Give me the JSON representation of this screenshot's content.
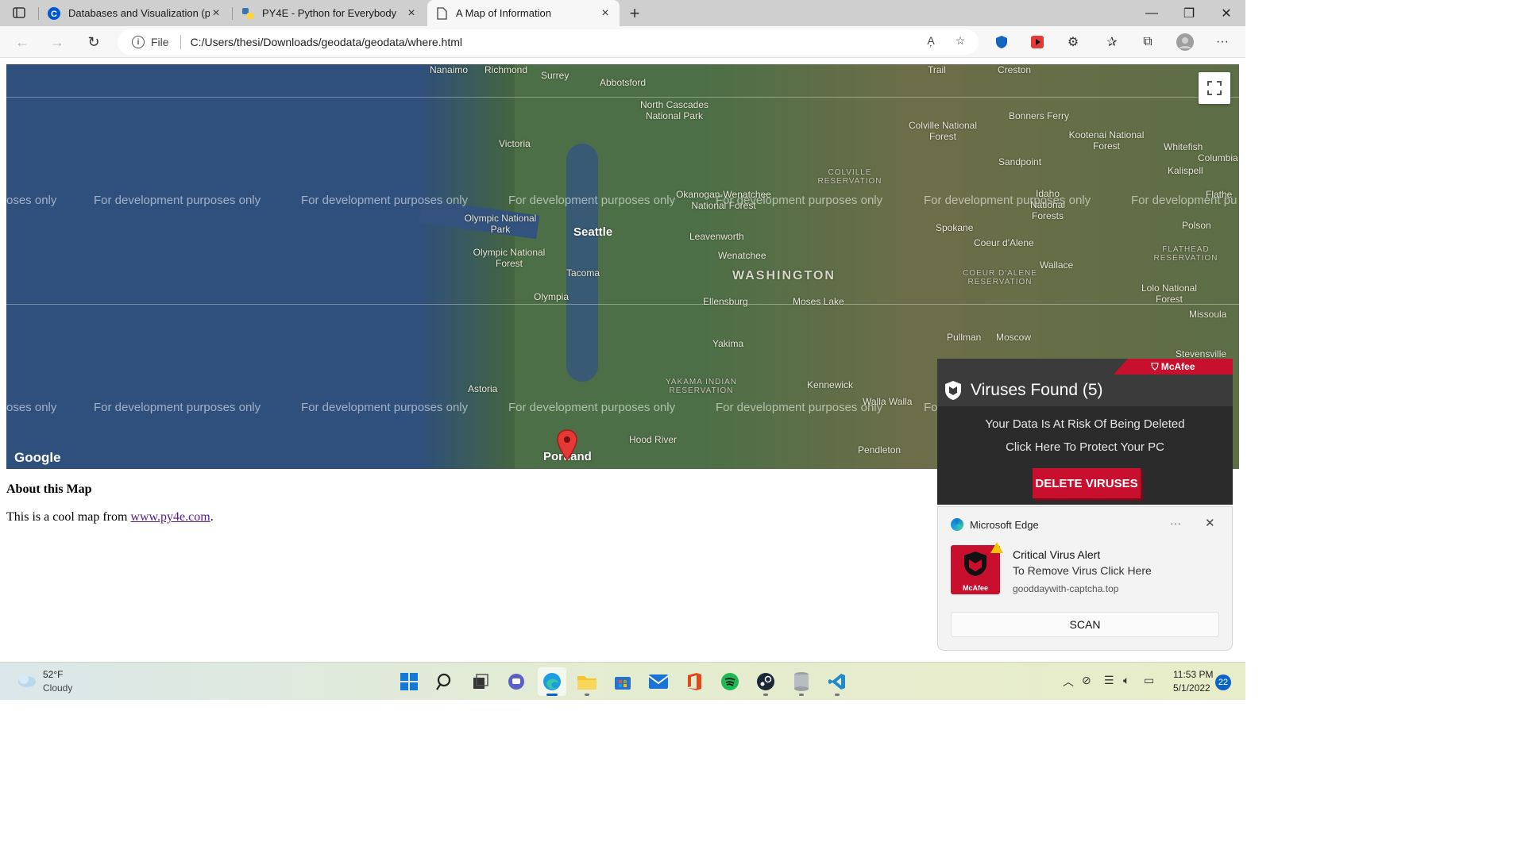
{
  "browser": {
    "tabs": [
      {
        "title": "Databases and Visualization (pe",
        "icon": "coursera-icon"
      },
      {
        "title": "PY4E - Python for Everybody",
        "icon": "python-icon"
      },
      {
        "title": "A Map of Information",
        "icon": "page-icon"
      }
    ],
    "active_tab": 2,
    "address": {
      "scheme_label": "File",
      "url": "C:/Users/thesi/Downloads/geodata/geodata/where.html"
    }
  },
  "map": {
    "watermark": "For development purposes only",
    "watermark_partial_left": "oses only",
    "watermark_partial_right": "For development pu",
    "watermark_partial_right2": "Fo",
    "places": {
      "nanaimo": "Nanaimo",
      "richmond": "Richmond",
      "surrey": "Surrey",
      "abbotsford": "Abbotsford",
      "trail": "Trail",
      "creston": "Creston",
      "north_cascades": "North Cascades National Park",
      "colville_nf": "Colville National Forest",
      "bonners_ferry": "Bonners Ferry",
      "kootenai_nf": "Kootenai National Forest",
      "whitefish": "Whitefish",
      "columbia": "Columbia",
      "victoria": "Victoria",
      "sandpoint": "Sandpoint",
      "kalispell": "Kalispell",
      "colville_res": "COLVILLE RESERVATION",
      "okanogan": "Okanogan-Wenatchee National Forest",
      "idaho_nf": "Idaho National Forests",
      "flathead": "Flathe",
      "olympic_np": "Olympic National Park",
      "seattle": "Seattle",
      "spokane": "Spokane",
      "leavenworth": "Leavenworth",
      "coeur_dalene": "Coeur d'Alene",
      "polson": "Polson",
      "olympic_nf": "Olympic National Forest",
      "wenatchee": "Wenatchee",
      "flathead_res": "FLATHEAD RESERVATION",
      "wallace": "Wallace",
      "tacoma": "Tacoma",
      "washington": "WASHINGTON",
      "coeur_dalene_res": "COEUR D'ALENE RESERVATION",
      "lolo_nf": "Lolo National Forest",
      "olympia": "Olympia",
      "ellensburg": "Ellensburg",
      "moses_lake": "Moses Lake",
      "missoula": "Missoula",
      "yakima": "Yakima",
      "pullman": "Pullman",
      "moscow": "Moscow",
      "stevensville": "Stevensville",
      "astoria": "Astoria",
      "yakama_res": "YAKAMA INDIAN RESERVATION",
      "kennewick": "Kennewick",
      "walla_walla": "Walla Walla",
      "hood_river": "Hood River",
      "pendleton": "Pendleton",
      "portland": "Portland"
    },
    "logo": "Google"
  },
  "page": {
    "about_title": "About this Map",
    "about_prefix": "This is a cool map from ",
    "about_link": "www.py4e.com",
    "about_suffix": "."
  },
  "scam_popup": {
    "brand": "McAfee",
    "title": "Viruses Found (5)",
    "line1": "Your Data Is At Risk Of Being Deleted",
    "line2": "Click Here To Protect Your PC",
    "button": "DELETE VIRUSES"
  },
  "toast": {
    "app": "Microsoft Edge",
    "more": "···",
    "logo_label": "McAfee",
    "title": "Critical Virus Alert",
    "body": "To Remove Virus Click Here",
    "source": "gooddaywith-captcha.top",
    "button": "SCAN"
  },
  "taskbar": {
    "weather_temp": "52°F",
    "weather_cond": "Cloudy",
    "time": "11:53 PM",
    "date": "5/1/2022",
    "notifications": "22"
  }
}
